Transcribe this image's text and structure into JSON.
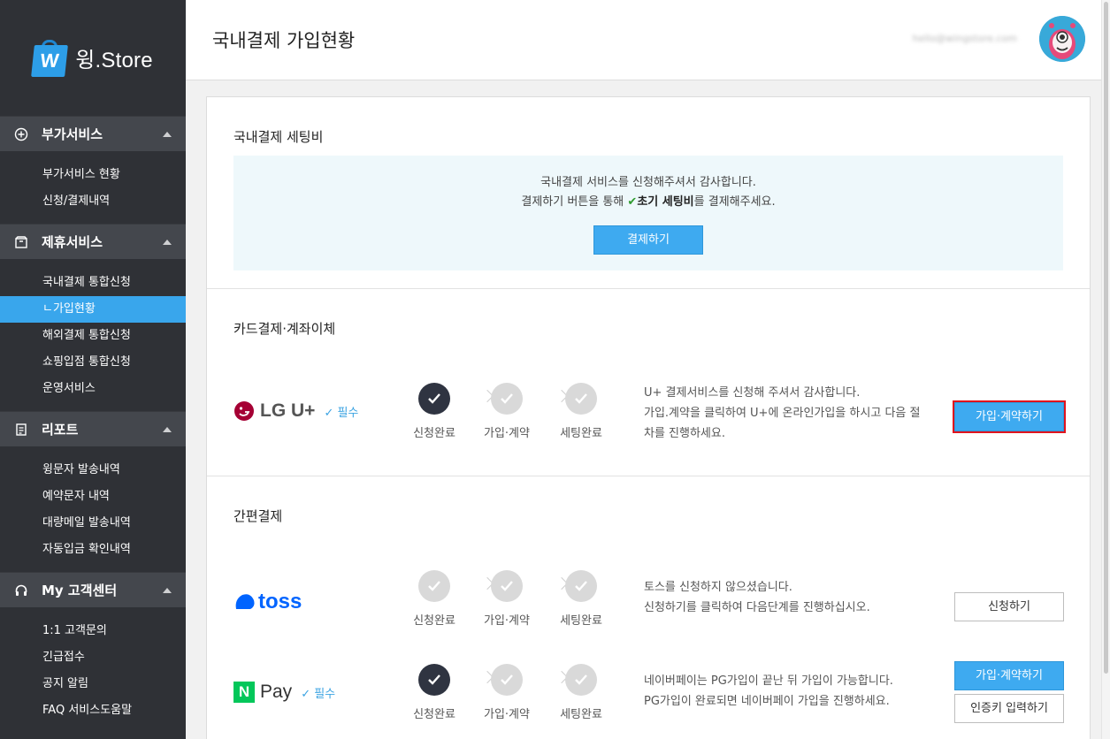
{
  "app": {
    "name": "윙.Store",
    "logo_letter": "W"
  },
  "sidebar": {
    "sections": [
      {
        "title": "부가서비스",
        "icon": "plus-circle-icon",
        "items": [
          "부가서비스 현황",
          "신청/결제내역"
        ]
      },
      {
        "title": "제휴서비스",
        "icon": "box-icon",
        "items": [
          "국내결제 통합신청",
          "ㄴ가입현황",
          "해외결제 통합신청",
          "쇼핑입점 통합신청",
          "운영서비스"
        ]
      },
      {
        "title": "리포트",
        "icon": "report-icon",
        "items": [
          "윙문자 발송내역",
          "예약문자 내역",
          "대량메일 발송내역",
          "자동입금 확인내역"
        ]
      },
      {
        "title": "My 고객센터",
        "icon": "headset-icon",
        "items": [
          "1:1 고객문의",
          "긴급접수",
          "공지 알림",
          "FAQ 서비스도움말"
        ]
      }
    ],
    "active_item": "ㄴ가입현황"
  },
  "header": {
    "title": "국내결제 가입현황",
    "email": "hello@wingstore.com"
  },
  "setting": {
    "title": "국내결제 세팅비",
    "line1": "국내결제 서비스를 신청해주셔서 감사합니다.",
    "line2_a": "결제하기 버튼을 통해 ",
    "line2_bold": "초기 세팅비",
    "line2_b": "를 결제해주세요.",
    "pay_button": "결제하기"
  },
  "steps_labels": [
    "신청완료",
    "가입·계약",
    "세팅완료"
  ],
  "card_section": {
    "title": "카드결제·계좌이체",
    "providers": [
      {
        "name": "LG U+",
        "required_label": "필수",
        "done_steps": 1,
        "desc_lines": [
          "U+ 결제서비스를 신청해 주셔서 감사합니다.",
          "가입.계약을 클릭하여 U+에 온라인가입을 하시고 다음 절",
          "차를 진행하세요."
        ],
        "button": "가입·계약하기"
      }
    ]
  },
  "simple_section": {
    "title": "간편결제",
    "providers": [
      {
        "name": "toss",
        "done_steps": 0,
        "desc_lines": [
          "토스를 신청하지 않으셨습니다.",
          "신청하기를 클릭하여 다음단계를 진행하십시오."
        ],
        "button": "신청하기"
      },
      {
        "name": "Pay",
        "logo_letter": "N",
        "required_label": "필수",
        "done_steps": 1,
        "desc_lines": [
          "네이버페이는 PG가입이 끝난 뒤 가입이 가능합니다.",
          "PG가입이 완료되면 네이버페이 가입을 진행하세요."
        ],
        "button": "가입·계약하기",
        "button2": "인증키 입력하기"
      }
    ]
  },
  "colors": {
    "accent": "#3eaaf0",
    "sidebar": "#2f3136",
    "highlight": "#e0141e",
    "lg_red": "#a50034",
    "toss_blue": "#0064ff",
    "naver_green": "#03c75a"
  }
}
